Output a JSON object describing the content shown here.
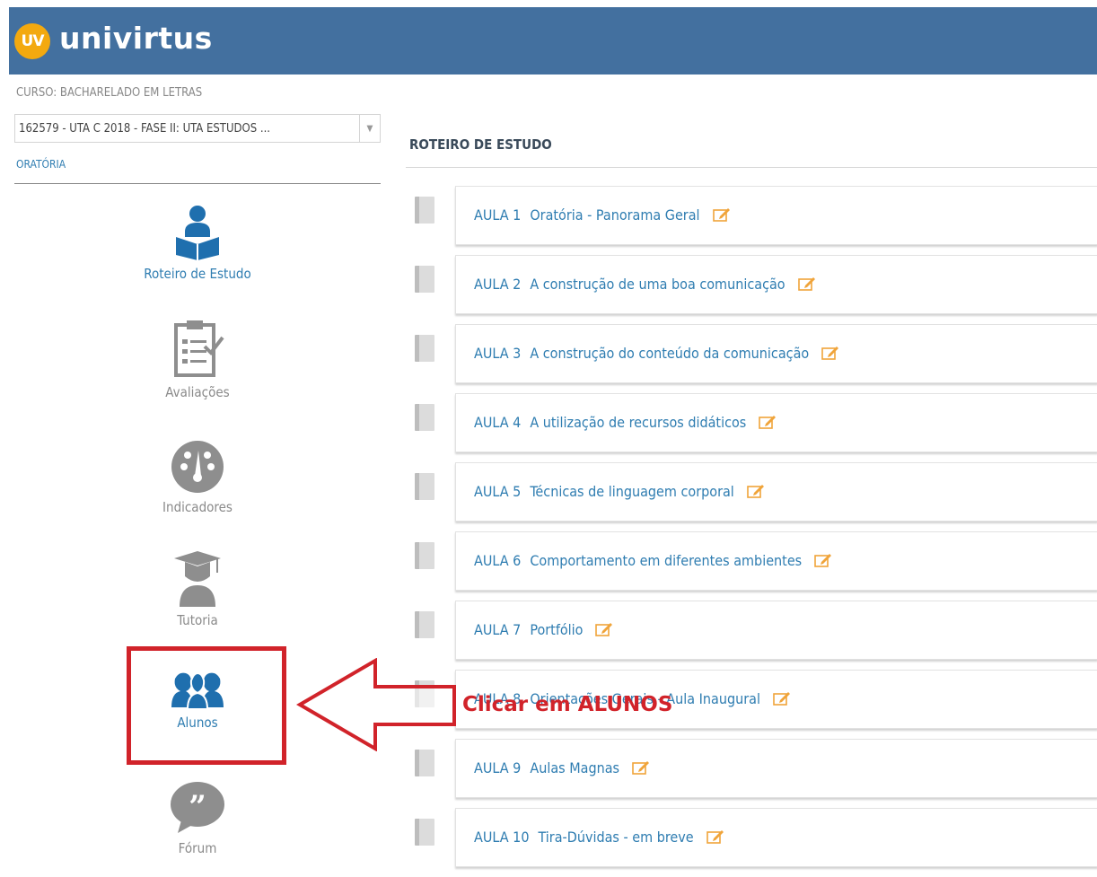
{
  "header": {
    "logo_badge": "UV",
    "logo_text": "univirtus",
    "brand_color": "#43709f",
    "badge_color": "#f3a90f"
  },
  "sidebar": {
    "course_label": "CURSO: BACHARELADO EM LETRAS",
    "course_select": "162579 - UTA C 2018 - FASE II: UTA ESTUDOS ...",
    "subject_link": "ORATÓRIA",
    "nav": [
      {
        "label": "Roteiro de Estudo",
        "icon": "student-reading-icon",
        "active": true
      },
      {
        "label": "Avaliações",
        "icon": "clipboard-check-icon",
        "active": false
      },
      {
        "label": "Indicadores",
        "icon": "gauge-icon",
        "active": false
      },
      {
        "label": "Tutoria",
        "icon": "graduate-icon",
        "active": false
      },
      {
        "label": "Alunos",
        "icon": "students-group-icon",
        "active": true
      },
      {
        "label": "Fórum",
        "icon": "quote-bubble-icon",
        "active": false
      }
    ]
  },
  "main": {
    "section_title": "ROTEIRO DE ESTUDO",
    "lessons": [
      {
        "num": "AULA 1",
        "title": "Oratória - Panorama Geral"
      },
      {
        "num": "AULA 2",
        "title": "A construção de uma boa comunicação"
      },
      {
        "num": "AULA 3",
        "title": "A construção do conteúdo da comunicação"
      },
      {
        "num": "AULA 4",
        "title": "A utilização de recursos didáticos"
      },
      {
        "num": "AULA 5",
        "title": "Técnicas de linguagem corporal"
      },
      {
        "num": "AULA 6",
        "title": "Comportamento em diferentes ambientes"
      },
      {
        "num": "AULA 7",
        "title": "Portfólio"
      },
      {
        "num": "AULA 8",
        "title": "Orientações Gerais - Aula Inaugural"
      },
      {
        "num": "AULA 9",
        "title": "Aulas Magnas"
      },
      {
        "num": "AULA 10",
        "title": "Tira-Dúvidas - em breve"
      }
    ]
  },
  "annotation": {
    "callout": "Clicar em ALUNOS",
    "color": "#d1232a"
  }
}
